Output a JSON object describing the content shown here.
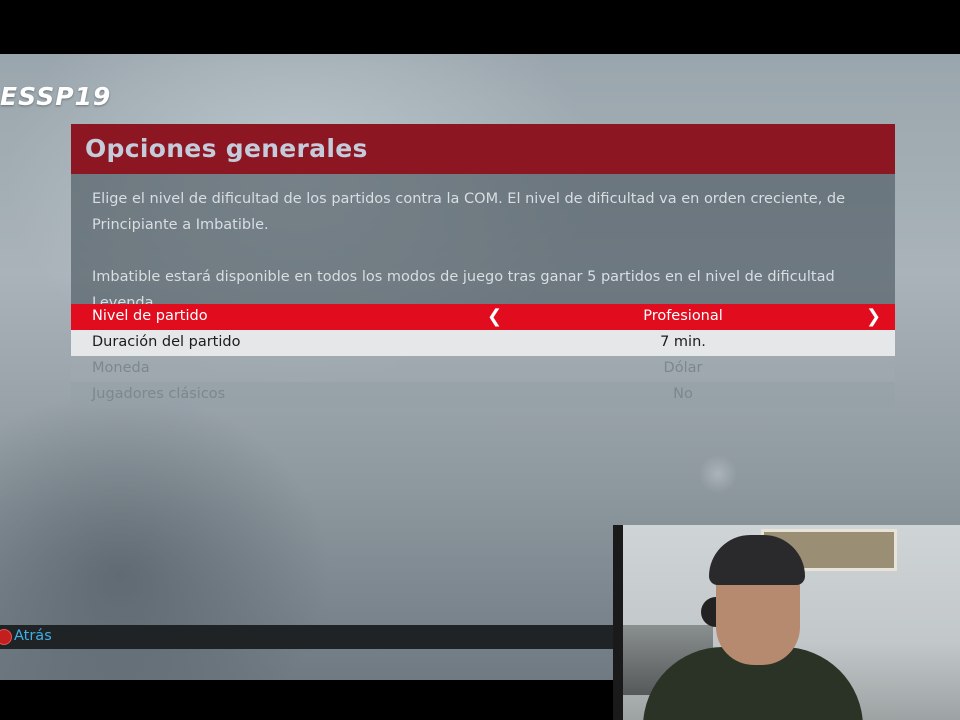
{
  "game": {
    "logo": "ESSP19",
    "screen_title": "Opciones generales",
    "description": {
      "paragraph1": "Elige el nivel de dificultad de los partidos contra la COM. El nivel de dificultad va en orden creciente, de Principiante a Imbatible.",
      "paragraph2": "Imbatible estará disponible en todos los modos de juego tras ganar 5 partidos en el nivel de dificultad Leyenda."
    },
    "options": [
      {
        "label": "Nivel de partido",
        "value": "Profesional"
      },
      {
        "label": "Duración del partido",
        "value": "7 min."
      },
      {
        "label": "Moneda",
        "value": "Dólar"
      },
      {
        "label": "Jugadores clásicos",
        "value": "No"
      }
    ],
    "arrows": {
      "left": "❮",
      "right": "❯"
    },
    "footer": {
      "back_label": "Atrás"
    }
  },
  "colors": {
    "header_bg": "#8c1622",
    "selected_row": "#e10c1d",
    "active_row": "#e6e7e8",
    "back_label": "#3fb0e6"
  }
}
